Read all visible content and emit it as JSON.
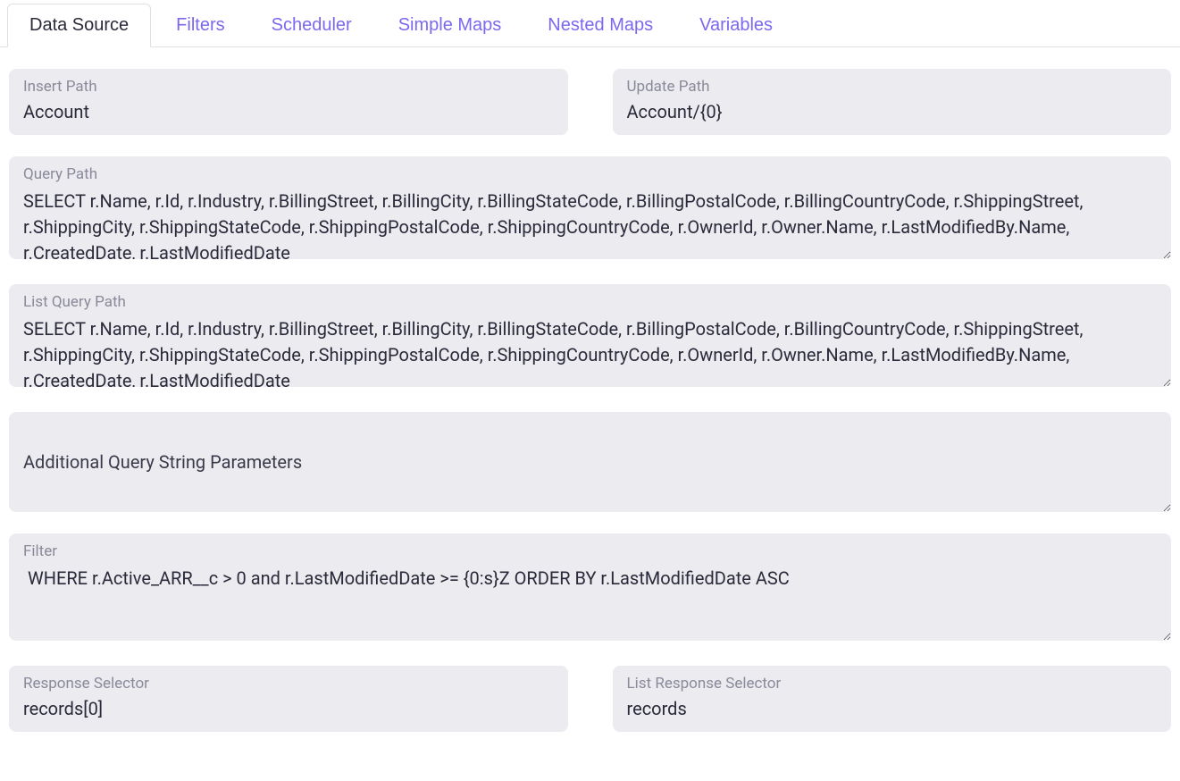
{
  "tabs": [
    {
      "label": "Data Source",
      "active": true
    },
    {
      "label": "Filters",
      "active": false
    },
    {
      "label": "Scheduler",
      "active": false
    },
    {
      "label": "Simple Maps",
      "active": false
    },
    {
      "label": "Nested Maps",
      "active": false
    },
    {
      "label": "Variables",
      "active": false
    }
  ],
  "fields": {
    "insert_path": {
      "label": "Insert Path",
      "value": "Account"
    },
    "update_path": {
      "label": "Update Path",
      "value": "Account/{0}"
    },
    "query_path": {
      "label": "Query Path",
      "value": "SELECT r.Name, r.Id, r.Industry, r.BillingStreet, r.BillingCity, r.BillingStateCode, r.BillingPostalCode, r.BillingCountryCode, r.ShippingStreet, r.ShippingCity, r.ShippingStateCode, r.ShippingPostalCode, r.ShippingCountryCode, r.OwnerId, r.Owner.Name, r.LastModifiedBy.Name, r.CreatedDate, r.LastModifiedDate"
    },
    "list_query_path": {
      "label": "List Query Path",
      "value": "SELECT r.Name, r.Id, r.Industry, r.BillingStreet, r.BillingCity, r.BillingStateCode, r.BillingPostalCode, r.BillingCountryCode, r.ShippingStreet, r.ShippingCity, r.ShippingStateCode, r.ShippingPostalCode, r.ShippingCountryCode, r.OwnerId, r.Owner.Name, r.LastModifiedBy.Name, r.CreatedDate, r.LastModifiedDate"
    },
    "additional_params": {
      "label": "Additional Query String Parameters",
      "value": ""
    },
    "filter": {
      "label": "Filter",
      "value": " WHERE r.Active_ARR__c > 0 and r.LastModifiedDate >= {0:s}Z ORDER BY r.LastModifiedDate ASC"
    },
    "response_selector": {
      "label": "Response Selector",
      "value": "records[0]"
    },
    "list_response_selector": {
      "label": "List Response Selector",
      "value": "records"
    }
  }
}
